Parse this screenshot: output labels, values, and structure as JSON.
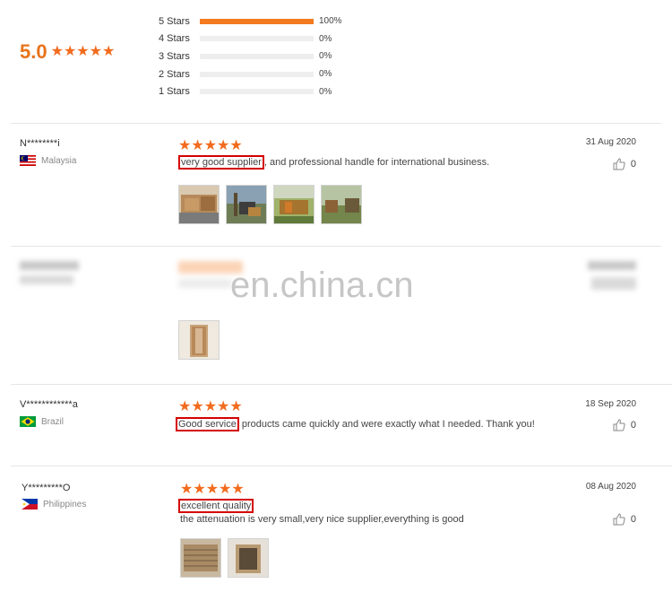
{
  "summary": {
    "average": "5.0",
    "distribution": [
      {
        "label": "5 Stars",
        "percent": "100%",
        "fraction": 1.0
      },
      {
        "label": "4 Stars",
        "percent": "0%",
        "fraction": 0
      },
      {
        "label": "3 Stars",
        "percent": "0%",
        "fraction": 0
      },
      {
        "label": "2 Stars",
        "percent": "0%",
        "fraction": 0
      },
      {
        "label": "1 Stars",
        "percent": "0%",
        "fraction": 0
      }
    ]
  },
  "star_char": "★★★★★",
  "reviews": [
    {
      "name": "N********i",
      "country": "Malaysia",
      "date": "31 Aug 2020",
      "likes": "0",
      "highlight": "very good supplier",
      "text": ", and professional handle for international business."
    },
    {
      "photos_note": "blurred review"
    },
    {
      "name": "V************a",
      "country": "Brazil",
      "date": "18 Sep 2020",
      "likes": "0",
      "highlight": "Good service",
      "text": " products came quickly and were exactly what I needed. Thank you!"
    },
    {
      "name": "Y*********O",
      "country": "Philippines",
      "date": "08 Aug 2020",
      "likes": "0",
      "highlight": "excellent quality",
      "text": "the attenuation is very small,very nice supplier,everything is good"
    }
  ],
  "watermark": "en.china.cn",
  "colors": {
    "accent": "#f26b1d",
    "highlight_border": "#d40000"
  }
}
